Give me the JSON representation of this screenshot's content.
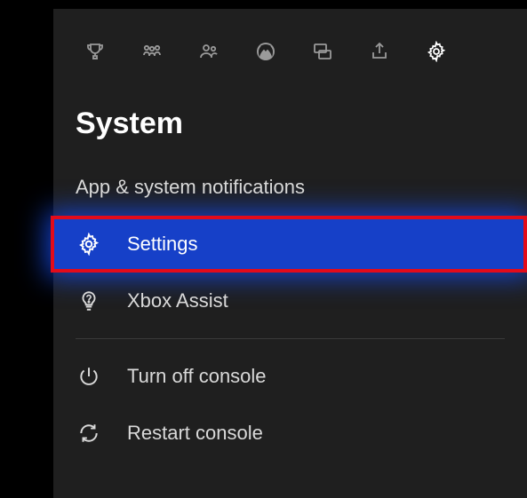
{
  "header": {
    "title": "System"
  },
  "tabs": [
    {
      "name": "achievements"
    },
    {
      "name": "multiplayer"
    },
    {
      "name": "people"
    },
    {
      "name": "home"
    },
    {
      "name": "chat"
    },
    {
      "name": "share"
    },
    {
      "name": "system"
    }
  ],
  "menu": {
    "notifications": "App & system notifications",
    "settings": "Settings",
    "xbox_assist": "Xbox Assist",
    "turn_off": "Turn off console",
    "restart": "Restart console"
  }
}
